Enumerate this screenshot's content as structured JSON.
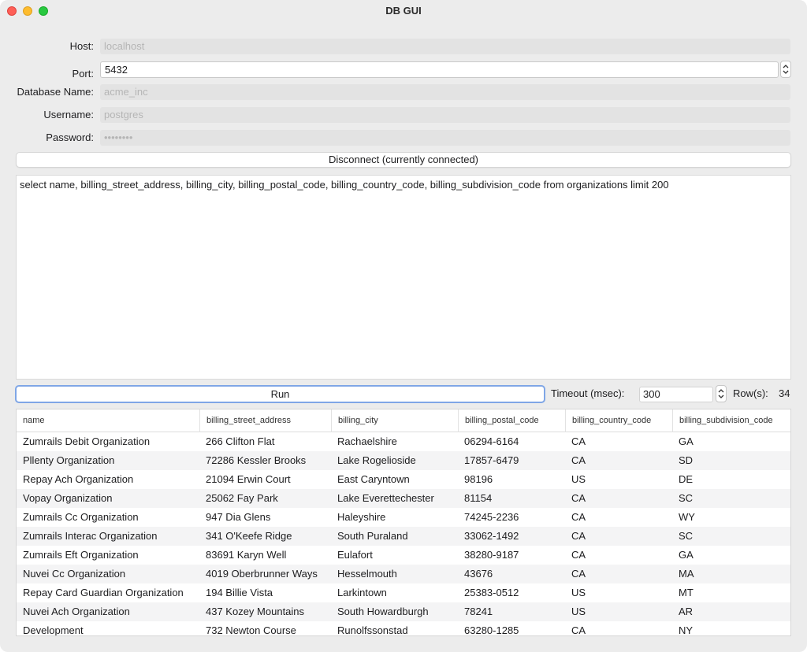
{
  "window": {
    "title": "DB GUI"
  },
  "connection": {
    "host_label": "Host:",
    "host_value": "localhost",
    "port_label": "Port:",
    "port_value": "5432",
    "db_label": "Database Name:",
    "db_value": "acme_inc",
    "user_label": "Username:",
    "user_value": "postgres",
    "password_label": "Password:",
    "password_value": "••••••••",
    "disconnect_label": "Disconnect (currently connected)"
  },
  "query": {
    "text": "select name, billing_street_address, billing_city, billing_postal_code, billing_country_code, billing_subdivision_code from organizations limit 200"
  },
  "controls": {
    "run_label": "Run",
    "timeout_label": "Timeout (msec):",
    "timeout_value": "300",
    "rows_label": "Row(s):",
    "rows_value": "34"
  },
  "results": {
    "columns": [
      "name",
      "billing_street_address",
      "billing_city",
      "billing_postal_code",
      "billing_country_code",
      "billing_subdivision_code"
    ],
    "rows": [
      [
        "Zumrails Debit Organization",
        "266 Clifton Flat",
        "Rachaelshire",
        "06294-6164",
        "CA",
        "GA"
      ],
      [
        "Pllenty Organization",
        "72286 Kessler Brooks",
        "Lake Rogelioside",
        "17857-6479",
        "CA",
        "SD"
      ],
      [
        "Repay Ach Organization",
        "21094 Erwin Court",
        "East Caryntown",
        "98196",
        "US",
        "DE"
      ],
      [
        "Vopay Organization",
        "25062 Fay Park",
        "Lake Everettechester",
        "81154",
        "CA",
        "SC"
      ],
      [
        "Zumrails Cc Organization",
        "947 Dia Glens",
        "Haleyshire",
        "74245-2236",
        "CA",
        "WY"
      ],
      [
        "Zumrails Interac Organization",
        "341 O'Keefe Ridge",
        "South Puraland",
        "33062-1492",
        "CA",
        "SC"
      ],
      [
        "Zumrails Eft Organization",
        "83691 Karyn Well",
        "Eulafort",
        "38280-9187",
        "CA",
        "GA"
      ],
      [
        "Nuvei Cc Organization",
        "4019 Oberbrunner Ways",
        "Hesselmouth",
        "43676",
        "CA",
        "MA"
      ],
      [
        "Repay Card Guardian Organization",
        "194 Billie Vista",
        "Larkintown",
        "25383-0512",
        "US",
        "MT"
      ],
      [
        "Nuvei Ach Organization",
        "437 Kozey Mountains",
        "South Howardburgh",
        "78241",
        "US",
        "AR"
      ],
      [
        "Development",
        "732 Newton Course",
        "Runolfssonstad",
        "63280-1285",
        "CA",
        "NY"
      ]
    ]
  }
}
